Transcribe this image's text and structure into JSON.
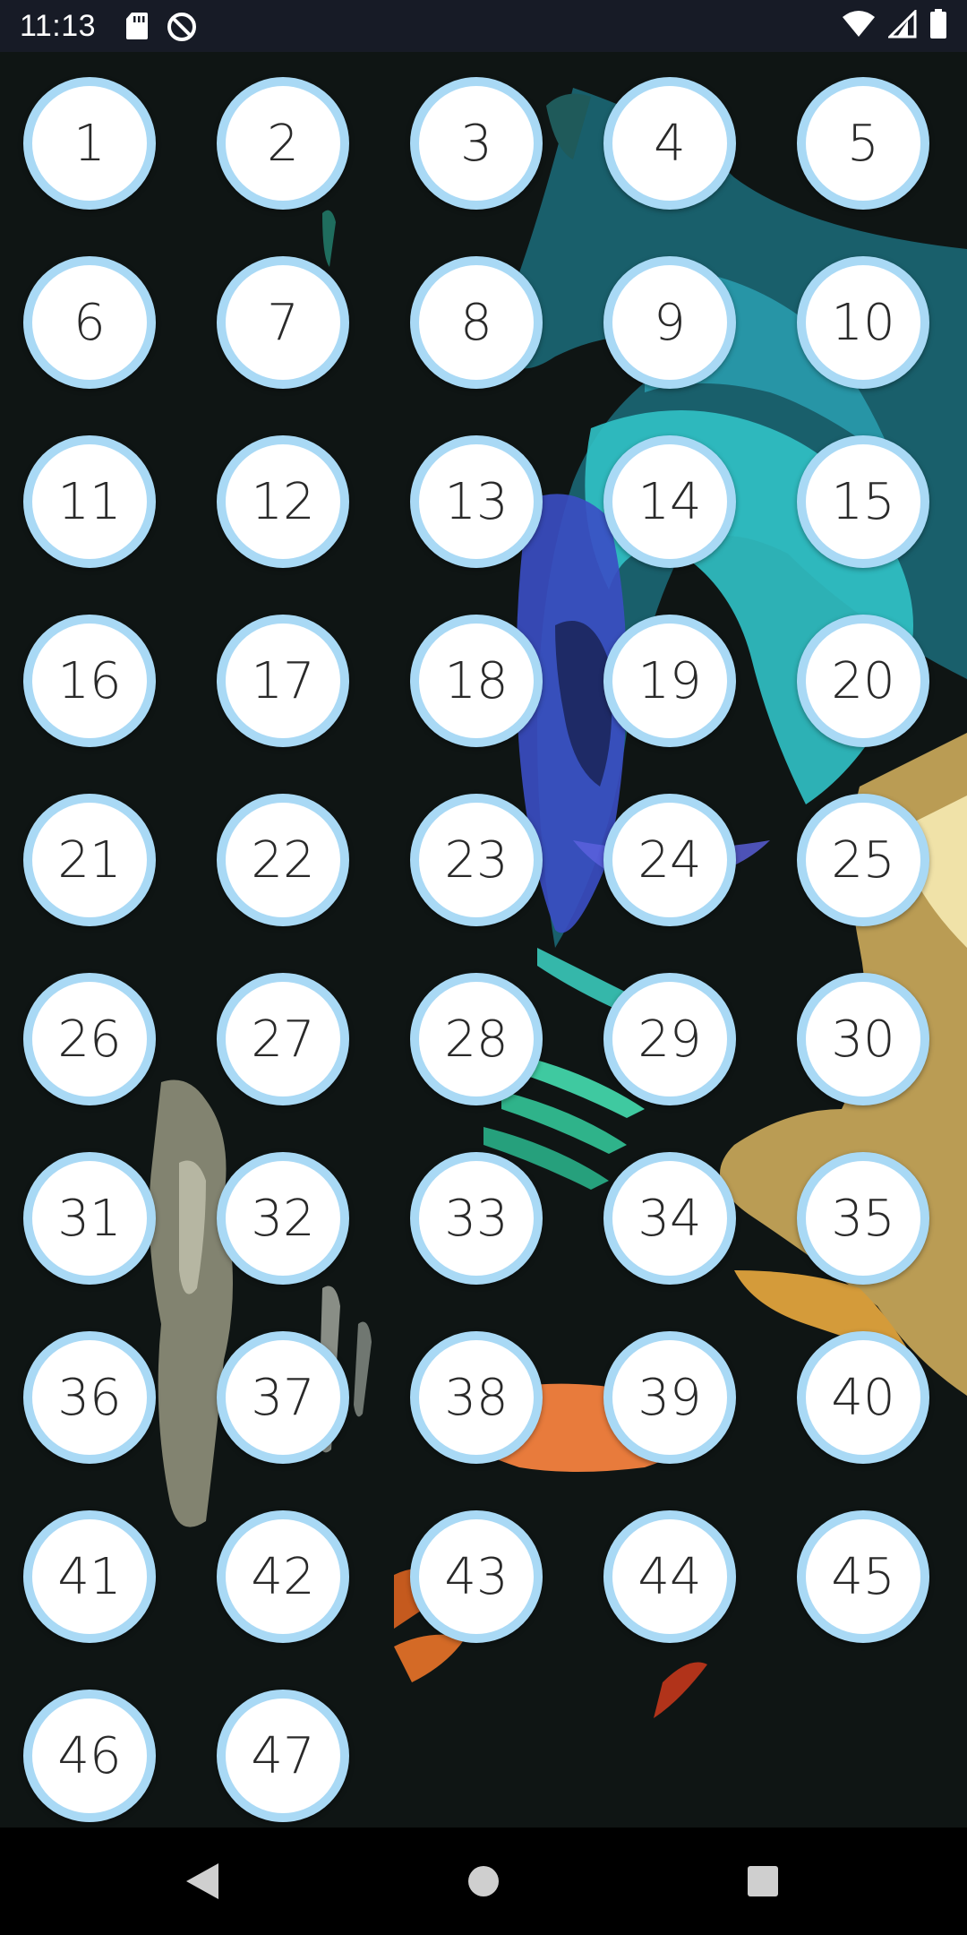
{
  "status_bar": {
    "time": "11:13",
    "left_icons": [
      "sd-card-icon",
      "data-saver-icon"
    ],
    "right_icons": [
      "wifi-icon",
      "cellular-signal-icon",
      "battery-icon"
    ]
  },
  "colors": {
    "status_bar_bg": "#171b26",
    "button_fill": "#ffffff",
    "button_ring": "#a9d9f5",
    "button_text": "#2a2a2a",
    "nav_bar_bg": "#000000"
  },
  "numbers": [
    "1",
    "2",
    "3",
    "4",
    "5",
    "6",
    "7",
    "8",
    "9",
    "10",
    "11",
    "12",
    "13",
    "14",
    "15",
    "16",
    "17",
    "18",
    "19",
    "20",
    "21",
    "22",
    "23",
    "24",
    "25",
    "26",
    "27",
    "28",
    "29",
    "30",
    "31",
    "32",
    "33",
    "34",
    "35",
    "36",
    "37",
    "38",
    "39",
    "40",
    "41",
    "42",
    "43",
    "44",
    "45",
    "46",
    "47"
  ],
  "nav_bar": {
    "buttons": [
      "back-icon",
      "home-icon",
      "recents-icon"
    ]
  }
}
